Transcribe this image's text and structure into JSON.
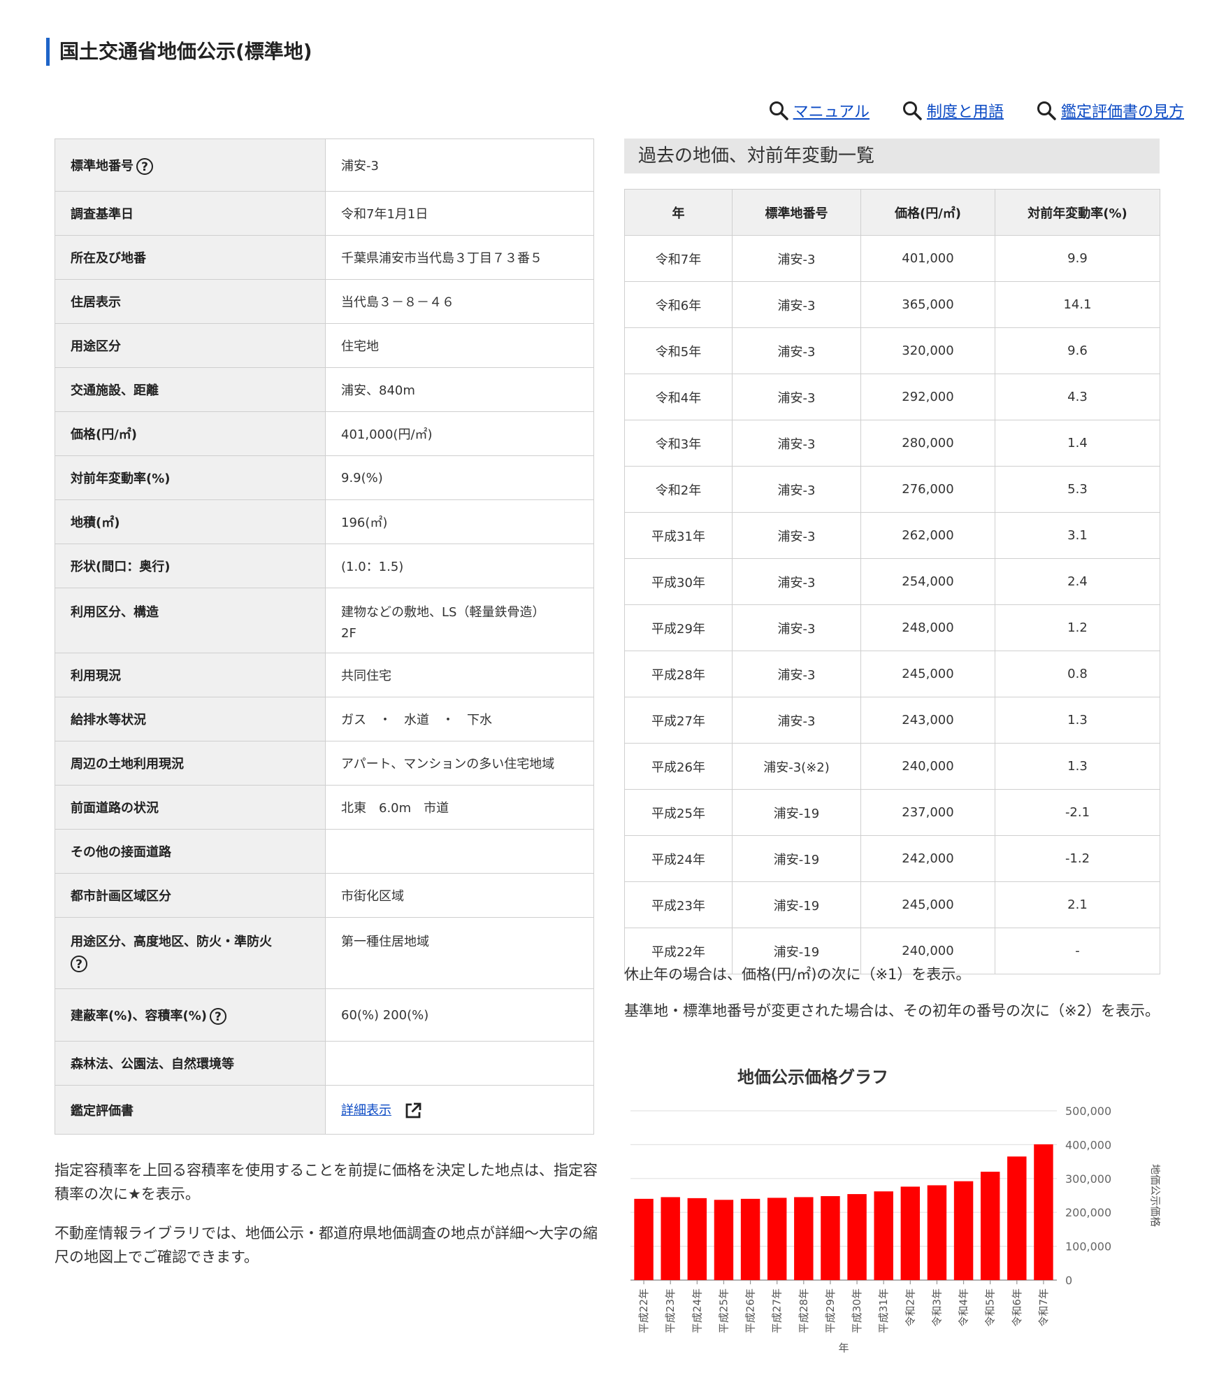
{
  "page_title": "国土交通省地価公示(標準地)",
  "help_links": [
    {
      "label": "マニュアル",
      "icon": "search-icon"
    },
    {
      "label": "制度と用語",
      "icon": "search-icon"
    },
    {
      "label": "鑑定評価書の見方",
      "icon": "search-icon"
    }
  ],
  "details": {
    "standard_no": {
      "label": "標準地番号",
      "value": "浦安-3"
    },
    "survey_date": {
      "label": "調査基準日",
      "value": "令和7年1月1日"
    },
    "location": {
      "label": "所在及び地番",
      "value": "千葉県浦安市当代島３丁目７３番５"
    },
    "address": {
      "label": "住居表示",
      "value": "当代島３－８－４６"
    },
    "use_type": {
      "label": "用途区分",
      "value": "住宅地"
    },
    "transport": {
      "label": "交通施設、距離",
      "value": "浦安、840m"
    },
    "price": {
      "label": "価格(円/㎡)",
      "value": "401,000(円/㎡)"
    },
    "change_rate": {
      "label": "対前年変動率(%)",
      "value": "9.9(%)"
    },
    "area": {
      "label": "地積(㎡)",
      "value": "196(㎡)"
    },
    "shape": {
      "label": "形状(間口：奥行)",
      "value": "(1.0：1.5)"
    },
    "structure": {
      "label": "利用区分、構造",
      "value_line1": "建物などの敷地、LS（軽量鉄骨造）",
      "value_line2": "2F"
    },
    "current_use": {
      "label": "利用現況",
      "value": "共同住宅"
    },
    "utilities": {
      "label": "給排水等状況",
      "value": "ガス　・　水道　・　下水"
    },
    "surroundings": {
      "label": "周辺の土地利用現況",
      "value": "アパート、マンションの多い住宅地域"
    },
    "front_road": {
      "label": "前面道路の状況",
      "value": "北東　6.0m　市道"
    },
    "other_road": {
      "label": "その他の接面道路",
      "value": ""
    },
    "city_plan": {
      "label": "都市計画区域区分",
      "value": "市街化区域"
    },
    "zoning": {
      "label": "用途区分、高度地区、防火・準防火",
      "value": "第一種住居地域"
    },
    "coverage": {
      "label": "建蔽率(%)、容積率(%)",
      "value": "60(%) 200(%)"
    },
    "laws": {
      "label": "森林法、公園法、自然環境等",
      "value": ""
    },
    "appraisal": {
      "label": "鑑定評価書",
      "link": "詳細表示"
    }
  },
  "left_notes": [
    "指定容積率を上回る容積率を使用することを前提に価格を決定した地点は、指定容積率の次に★を表示。",
    "不動産情報ライブラリでは、地価公示・都道府県地価調査の地点が詳細～大字の縮尺の地図上でご確認できます。"
  ],
  "history": {
    "title": "過去の地価、対前年変動一覧",
    "headers": [
      "年",
      "標準地番号",
      "価格(円/㎡)",
      "対前年変動率(%)"
    ],
    "rows": [
      [
        "令和7年",
        "浦安-3",
        "401,000",
        "9.9"
      ],
      [
        "令和6年",
        "浦安-3",
        "365,000",
        "14.1"
      ],
      [
        "令和5年",
        "浦安-3",
        "320,000",
        "9.6"
      ],
      [
        "令和4年",
        "浦安-3",
        "292,000",
        "4.3"
      ],
      [
        "令和3年",
        "浦安-3",
        "280,000",
        "1.4"
      ],
      [
        "令和2年",
        "浦安-3",
        "276,000",
        "5.3"
      ],
      [
        "平成31年",
        "浦安-3",
        "262,000",
        "3.1"
      ],
      [
        "平成30年",
        "浦安-3",
        "254,000",
        "2.4"
      ],
      [
        "平成29年",
        "浦安-3",
        "248,000",
        "1.2"
      ],
      [
        "平成28年",
        "浦安-3",
        "245,000",
        "0.8"
      ],
      [
        "平成27年",
        "浦安-3",
        "243,000",
        "1.3"
      ],
      [
        "平成26年",
        "浦安-3(※2)",
        "240,000",
        "1.3"
      ],
      [
        "平成25年",
        "浦安-19",
        "237,000",
        "-2.1"
      ],
      [
        "平成24年",
        "浦安-19",
        "242,000",
        "-1.2"
      ],
      [
        "平成23年",
        "浦安-19",
        "245,000",
        "2.1"
      ],
      [
        "平成22年",
        "浦安-19",
        "240,000",
        "-"
      ]
    ]
  },
  "right_notes": [
    "休止年の場合は、価格(円/㎡)の次に（※1）を表示。",
    "基準地・標準地番号が変更された場合は、その初年の番号の次に（※2）を表示。"
  ],
  "chart_data": {
    "type": "bar",
    "title": "地価公示価格グラフ",
    "xlabel": "年",
    "ylabel": "地価公示価格",
    "categories": [
      "平成22年",
      "平成23年",
      "平成24年",
      "平成25年",
      "平成26年",
      "平成27年",
      "平成28年",
      "平成29年",
      "平成30年",
      "平成31年",
      "令和2年",
      "令和3年",
      "令和4年",
      "令和5年",
      "令和6年",
      "令和7年"
    ],
    "values": [
      240000,
      245000,
      242000,
      237000,
      240000,
      243000,
      245000,
      248000,
      254000,
      262000,
      276000,
      280000,
      292000,
      320000,
      365000,
      401000
    ],
    "ylim": [
      0,
      500000
    ],
    "yticks": [
      0,
      100000,
      200000,
      300000,
      400000,
      500000
    ],
    "ytick_labels": [
      "0",
      "100,000",
      "200,000",
      "300,000",
      "400,000",
      "500,000"
    ],
    "bar_color": "#ff0000",
    "grid": true,
    "y_axis_side": "right"
  }
}
